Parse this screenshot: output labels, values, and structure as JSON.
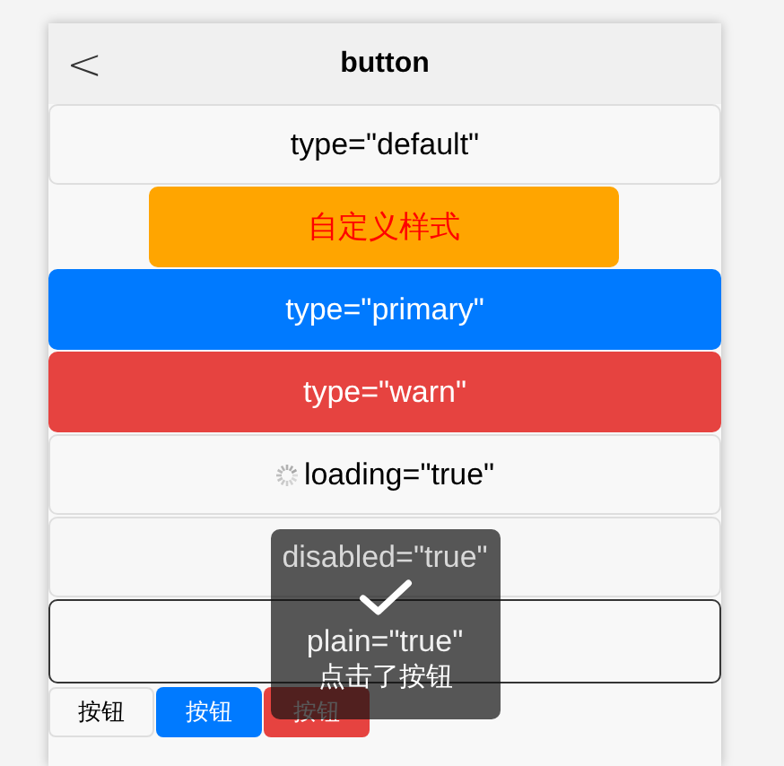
{
  "nav": {
    "back": "<",
    "title": "button"
  },
  "buttons": [
    {
      "kind": "default",
      "label": "type=\"default\""
    },
    {
      "kind": "custom",
      "label": "自定义样式"
    },
    {
      "kind": "primary",
      "label": "type=\"primary\""
    },
    {
      "kind": "warn",
      "label": "type=\"warn\""
    },
    {
      "kind": "loading",
      "label": "loading=\"true\""
    },
    {
      "kind": "disabled",
      "label": "disabled=\"true\""
    },
    {
      "kind": "plain",
      "label": "plain=\"true\""
    }
  ],
  "mini_buttons": [
    {
      "kind": "default",
      "label": "按钮"
    },
    {
      "kind": "primary",
      "label": "按钮"
    },
    {
      "kind": "warn",
      "label": "按钮"
    }
  ],
  "toast": {
    "text": "点击了按钮"
  }
}
